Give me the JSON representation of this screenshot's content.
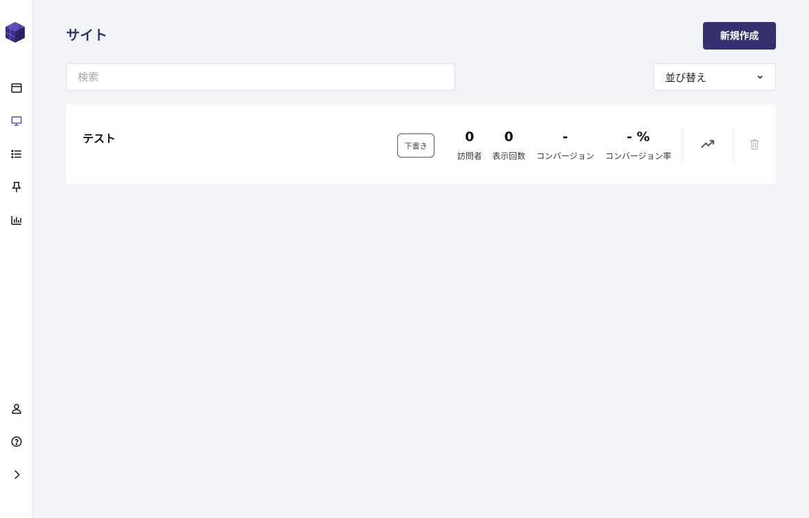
{
  "sidebar": {
    "logo": "cube-logo",
    "top_items": [
      {
        "icon": "browser-window-icon"
      },
      {
        "icon": "monitor-icon",
        "active": true
      },
      {
        "icon": "list-icon"
      },
      {
        "icon": "pin-icon"
      },
      {
        "icon": "bar-chart-icon"
      }
    ],
    "bottom_items": [
      {
        "icon": "user-icon"
      },
      {
        "icon": "help-icon"
      },
      {
        "icon": "chevron-right-icon"
      }
    ]
  },
  "header": {
    "title": "サイト",
    "new_button_label": "新規作成"
  },
  "search": {
    "placeholder": "検索",
    "value": ""
  },
  "sort": {
    "label": "並び替え"
  },
  "sites": [
    {
      "name": "テスト",
      "status": "下書き",
      "stats": [
        {
          "value": "0",
          "label": "訪問者"
        },
        {
          "value": "0",
          "label": "表示回数"
        },
        {
          "value": "-",
          "label": "コンバージョン"
        },
        {
          "value": "- %",
          "label": "コンバージョン率"
        }
      ]
    }
  ],
  "colors": {
    "brand": "#35306e",
    "active_icon": "#5a4fcf",
    "background": "#f2f3f6"
  }
}
